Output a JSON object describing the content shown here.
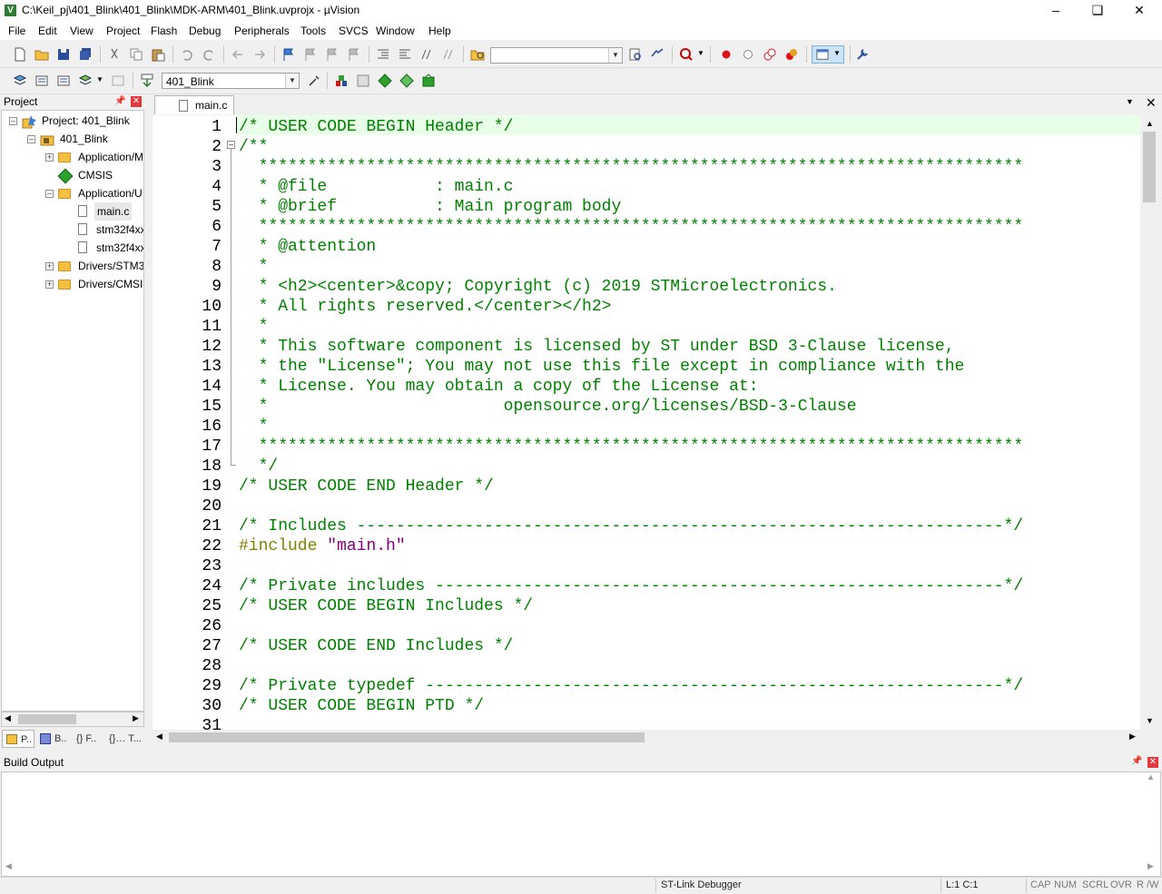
{
  "window": {
    "title": "C:\\Keil_pj\\401_Blink\\401_Blink\\MDK-ARM\\401_Blink.uvprojx - µVision",
    "app_icon_letter": "V"
  },
  "menu": [
    "File",
    "Edit",
    "View",
    "Project",
    "Flash",
    "Debug",
    "Peripherals",
    "Tools",
    "SVCS",
    "Window",
    "Help"
  ],
  "toolbar2": {
    "target": "401_Blink"
  },
  "project_panel": {
    "title": "Project",
    "tree": {
      "root": "Project: 401_Blink",
      "target": "401_Blink",
      "groups": [
        "Application/M",
        "CMSIS",
        "Application/U",
        "Drivers/STM3",
        "Drivers/CMSI"
      ],
      "files": [
        "main.c",
        "stm32f4xx",
        "stm32f4xx"
      ]
    },
    "tabs": [
      "P..",
      "B..",
      "{} F..",
      "{}… T..."
    ]
  },
  "editor": {
    "tab": "main.c",
    "lines": [
      {
        "n": "1",
        "t": "/* USER CODE BEGIN Header */",
        "c": "cmt"
      },
      {
        "n": "2",
        "t": "/**",
        "c": "cmt"
      },
      {
        "n": "3",
        "t": "  ******************************************************************************",
        "c": "cmt"
      },
      {
        "n": "4",
        "t": "  * @file           : main.c",
        "c": "cmt"
      },
      {
        "n": "5",
        "t": "  * @brief          : Main program body",
        "c": "cmt"
      },
      {
        "n": "6",
        "t": "  ******************************************************************************",
        "c": "cmt"
      },
      {
        "n": "7",
        "t": "  * @attention",
        "c": "cmt"
      },
      {
        "n": "8",
        "t": "  *",
        "c": "cmt"
      },
      {
        "n": "9",
        "t": "  * <h2><center>&copy; Copyright (c) 2019 STMicroelectronics.",
        "c": "cmt"
      },
      {
        "n": "10",
        "t": "  * All rights reserved.</center></h2>",
        "c": "cmt"
      },
      {
        "n": "11",
        "t": "  *",
        "c": "cmt"
      },
      {
        "n": "12",
        "t": "  * This software component is licensed by ST under BSD 3-Clause license,",
        "c": "cmt"
      },
      {
        "n": "13",
        "t": "  * the \"License\"; You may not use this file except in compliance with the",
        "c": "cmt"
      },
      {
        "n": "14",
        "t": "  * License. You may obtain a copy of the License at:",
        "c": "cmt"
      },
      {
        "n": "15",
        "t": "  *                        opensource.org/licenses/BSD-3-Clause",
        "c": "cmt"
      },
      {
        "n": "16",
        "t": "  *",
        "c": "cmt"
      },
      {
        "n": "17",
        "t": "  ******************************************************************************",
        "c": "cmt"
      },
      {
        "n": "18",
        "t": "  */",
        "c": "cmt"
      },
      {
        "n": "19",
        "t": "/* USER CODE END Header */",
        "c": "cmt"
      },
      {
        "n": "20",
        "t": "",
        "c": "cmt"
      },
      {
        "n": "21",
        "t": "/* Includes ------------------------------------------------------------------*/",
        "c": "cmt"
      },
      {
        "n": "22",
        "t": "",
        "c": "inc"
      },
      {
        "n": "23",
        "t": "",
        "c": "cmt"
      },
      {
        "n": "24",
        "t": "/* Private includes ----------------------------------------------------------*/",
        "c": "cmt"
      },
      {
        "n": "25",
        "t": "/* USER CODE BEGIN Includes */",
        "c": "cmt"
      },
      {
        "n": "26",
        "t": "",
        "c": "cmt"
      },
      {
        "n": "27",
        "t": "/* USER CODE END Includes */",
        "c": "cmt"
      },
      {
        "n": "28",
        "t": "",
        "c": "cmt"
      },
      {
        "n": "29",
        "t": "/* Private typedef -----------------------------------------------------------*/",
        "c": "cmt"
      },
      {
        "n": "30",
        "t": "/* USER CODE BEGIN PTD */",
        "c": "cmt"
      },
      {
        "n": "31",
        "t": "",
        "c": "cmt"
      }
    ],
    "include_directive": "#include",
    "include_file": "\"main.h\""
  },
  "build_output": {
    "title": "Build Output"
  },
  "status": {
    "debugger": "ST-Link Debugger",
    "position": "L:1 C:1",
    "indicators": [
      "CAP",
      "NUM",
      "SCRL",
      "OVR",
      "R /W"
    ]
  }
}
